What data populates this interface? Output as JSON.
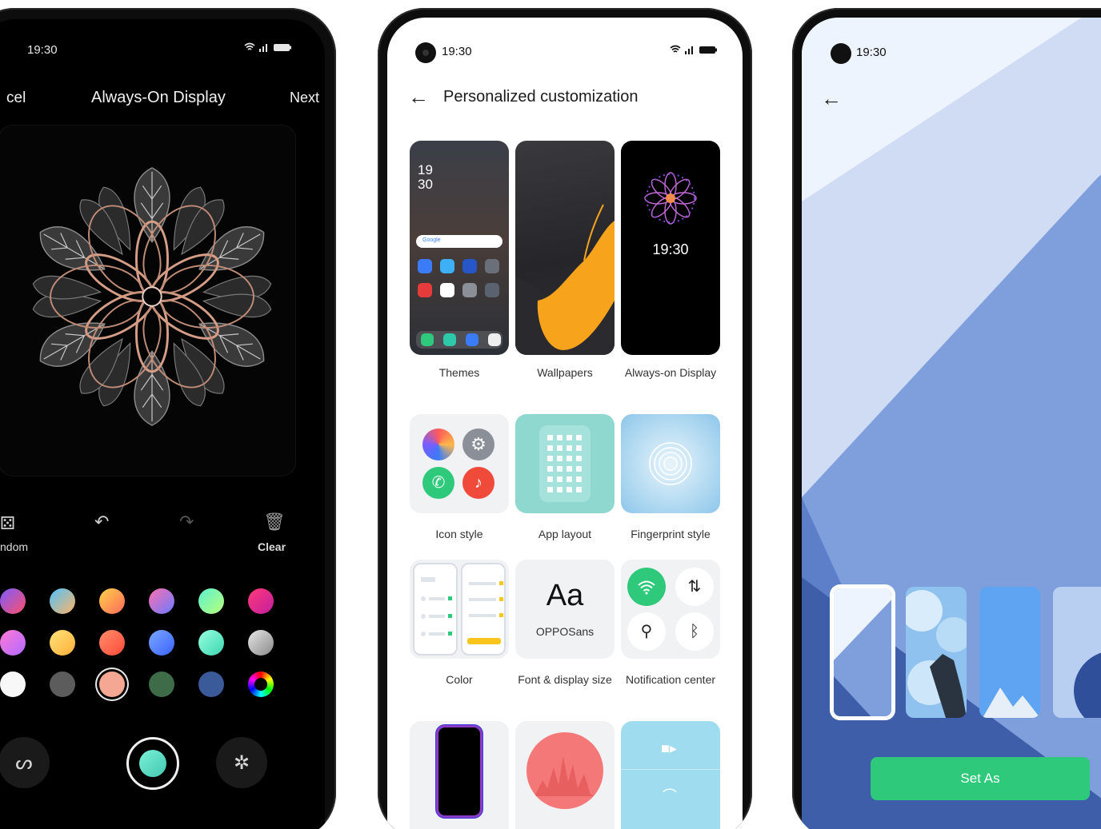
{
  "phone_left": {
    "status_time": "19:30",
    "status_icons": "wifi-icon signal-icon battery-icon",
    "cancel_label": "cel",
    "title": "Always-On Display",
    "next_label": "Next",
    "tools": {
      "random_label": "ndom",
      "clear_label": "Clear"
    },
    "selected_color": "#f4a792"
  },
  "phone_middle": {
    "status_time": "19:30",
    "title": "Personalized customization",
    "tiles": {
      "themes": "Themes",
      "wallpapers": "Wallpapers",
      "aod": "Always-on Display",
      "icon_style": "Icon style",
      "app_layout": "App layout",
      "fingerprint_style": "Fingerprint style",
      "color": "Color",
      "font_display": "Font & display size",
      "notification_center": "Notification center"
    },
    "themes_preview": {
      "time_hour": "19",
      "time_min": "30",
      "search_label": "Google"
    },
    "aod_preview_time": "19:30",
    "font_preview": {
      "sample": "Aa",
      "font_name": "OPPOSans"
    }
  },
  "phone_right": {
    "status_time": "19:30",
    "set_as_label": "Set As"
  }
}
